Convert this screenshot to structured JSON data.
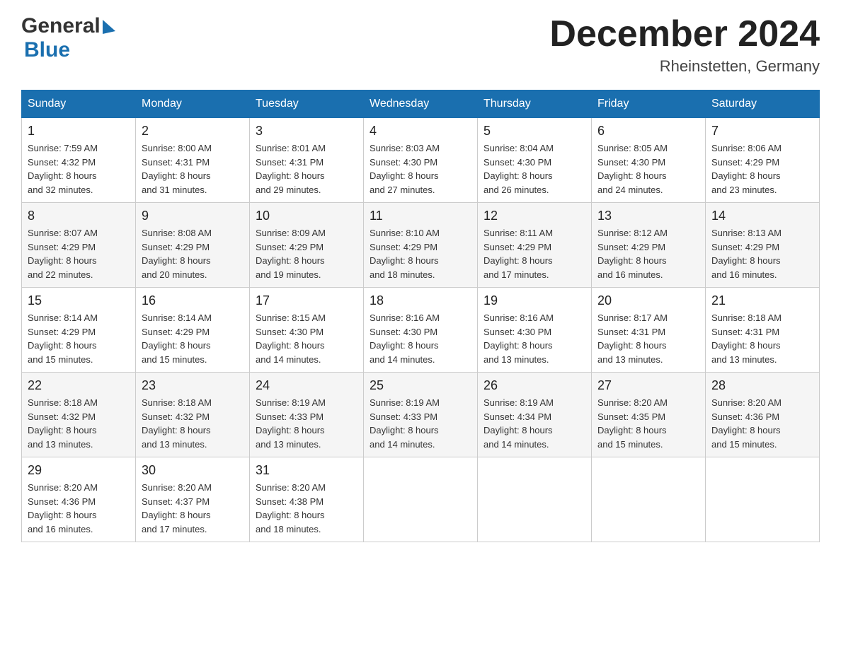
{
  "header": {
    "logo_general": "General",
    "logo_blue": "Blue",
    "title": "December 2024",
    "location": "Rheinstetten, Germany"
  },
  "days_of_week": [
    "Sunday",
    "Monday",
    "Tuesday",
    "Wednesday",
    "Thursday",
    "Friday",
    "Saturday"
  ],
  "weeks": [
    [
      {
        "num": "1",
        "sunrise": "7:59 AM",
        "sunset": "4:32 PM",
        "daylight": "8 hours and 32 minutes."
      },
      {
        "num": "2",
        "sunrise": "8:00 AM",
        "sunset": "4:31 PM",
        "daylight": "8 hours and 31 minutes."
      },
      {
        "num": "3",
        "sunrise": "8:01 AM",
        "sunset": "4:31 PM",
        "daylight": "8 hours and 29 minutes."
      },
      {
        "num": "4",
        "sunrise": "8:03 AM",
        "sunset": "4:30 PM",
        "daylight": "8 hours and 27 minutes."
      },
      {
        "num": "5",
        "sunrise": "8:04 AM",
        "sunset": "4:30 PM",
        "daylight": "8 hours and 26 minutes."
      },
      {
        "num": "6",
        "sunrise": "8:05 AM",
        "sunset": "4:30 PM",
        "daylight": "8 hours and 24 minutes."
      },
      {
        "num": "7",
        "sunrise": "8:06 AM",
        "sunset": "4:29 PM",
        "daylight": "8 hours and 23 minutes."
      }
    ],
    [
      {
        "num": "8",
        "sunrise": "8:07 AM",
        "sunset": "4:29 PM",
        "daylight": "8 hours and 22 minutes."
      },
      {
        "num": "9",
        "sunrise": "8:08 AM",
        "sunset": "4:29 PM",
        "daylight": "8 hours and 20 minutes."
      },
      {
        "num": "10",
        "sunrise": "8:09 AM",
        "sunset": "4:29 PM",
        "daylight": "8 hours and 19 minutes."
      },
      {
        "num": "11",
        "sunrise": "8:10 AM",
        "sunset": "4:29 PM",
        "daylight": "8 hours and 18 minutes."
      },
      {
        "num": "12",
        "sunrise": "8:11 AM",
        "sunset": "4:29 PM",
        "daylight": "8 hours and 17 minutes."
      },
      {
        "num": "13",
        "sunrise": "8:12 AM",
        "sunset": "4:29 PM",
        "daylight": "8 hours and 16 minutes."
      },
      {
        "num": "14",
        "sunrise": "8:13 AM",
        "sunset": "4:29 PM",
        "daylight": "8 hours and 16 minutes."
      }
    ],
    [
      {
        "num": "15",
        "sunrise": "8:14 AM",
        "sunset": "4:29 PM",
        "daylight": "8 hours and 15 minutes."
      },
      {
        "num": "16",
        "sunrise": "8:14 AM",
        "sunset": "4:29 PM",
        "daylight": "8 hours and 15 minutes."
      },
      {
        "num": "17",
        "sunrise": "8:15 AM",
        "sunset": "4:30 PM",
        "daylight": "8 hours and 14 minutes."
      },
      {
        "num": "18",
        "sunrise": "8:16 AM",
        "sunset": "4:30 PM",
        "daylight": "8 hours and 14 minutes."
      },
      {
        "num": "19",
        "sunrise": "8:16 AM",
        "sunset": "4:30 PM",
        "daylight": "8 hours and 13 minutes."
      },
      {
        "num": "20",
        "sunrise": "8:17 AM",
        "sunset": "4:31 PM",
        "daylight": "8 hours and 13 minutes."
      },
      {
        "num": "21",
        "sunrise": "8:18 AM",
        "sunset": "4:31 PM",
        "daylight": "8 hours and 13 minutes."
      }
    ],
    [
      {
        "num": "22",
        "sunrise": "8:18 AM",
        "sunset": "4:32 PM",
        "daylight": "8 hours and 13 minutes."
      },
      {
        "num": "23",
        "sunrise": "8:18 AM",
        "sunset": "4:32 PM",
        "daylight": "8 hours and 13 minutes."
      },
      {
        "num": "24",
        "sunrise": "8:19 AM",
        "sunset": "4:33 PM",
        "daylight": "8 hours and 13 minutes."
      },
      {
        "num": "25",
        "sunrise": "8:19 AM",
        "sunset": "4:33 PM",
        "daylight": "8 hours and 14 minutes."
      },
      {
        "num": "26",
        "sunrise": "8:19 AM",
        "sunset": "4:34 PM",
        "daylight": "8 hours and 14 minutes."
      },
      {
        "num": "27",
        "sunrise": "8:20 AM",
        "sunset": "4:35 PM",
        "daylight": "8 hours and 15 minutes."
      },
      {
        "num": "28",
        "sunrise": "8:20 AM",
        "sunset": "4:36 PM",
        "daylight": "8 hours and 15 minutes."
      }
    ],
    [
      {
        "num": "29",
        "sunrise": "8:20 AM",
        "sunset": "4:36 PM",
        "daylight": "8 hours and 16 minutes."
      },
      {
        "num": "30",
        "sunrise": "8:20 AM",
        "sunset": "4:37 PM",
        "daylight": "8 hours and 17 minutes."
      },
      {
        "num": "31",
        "sunrise": "8:20 AM",
        "sunset": "4:38 PM",
        "daylight": "8 hours and 18 minutes."
      },
      null,
      null,
      null,
      null
    ]
  ],
  "labels": {
    "sunrise": "Sunrise:",
    "sunset": "Sunset:",
    "daylight": "Daylight:"
  }
}
